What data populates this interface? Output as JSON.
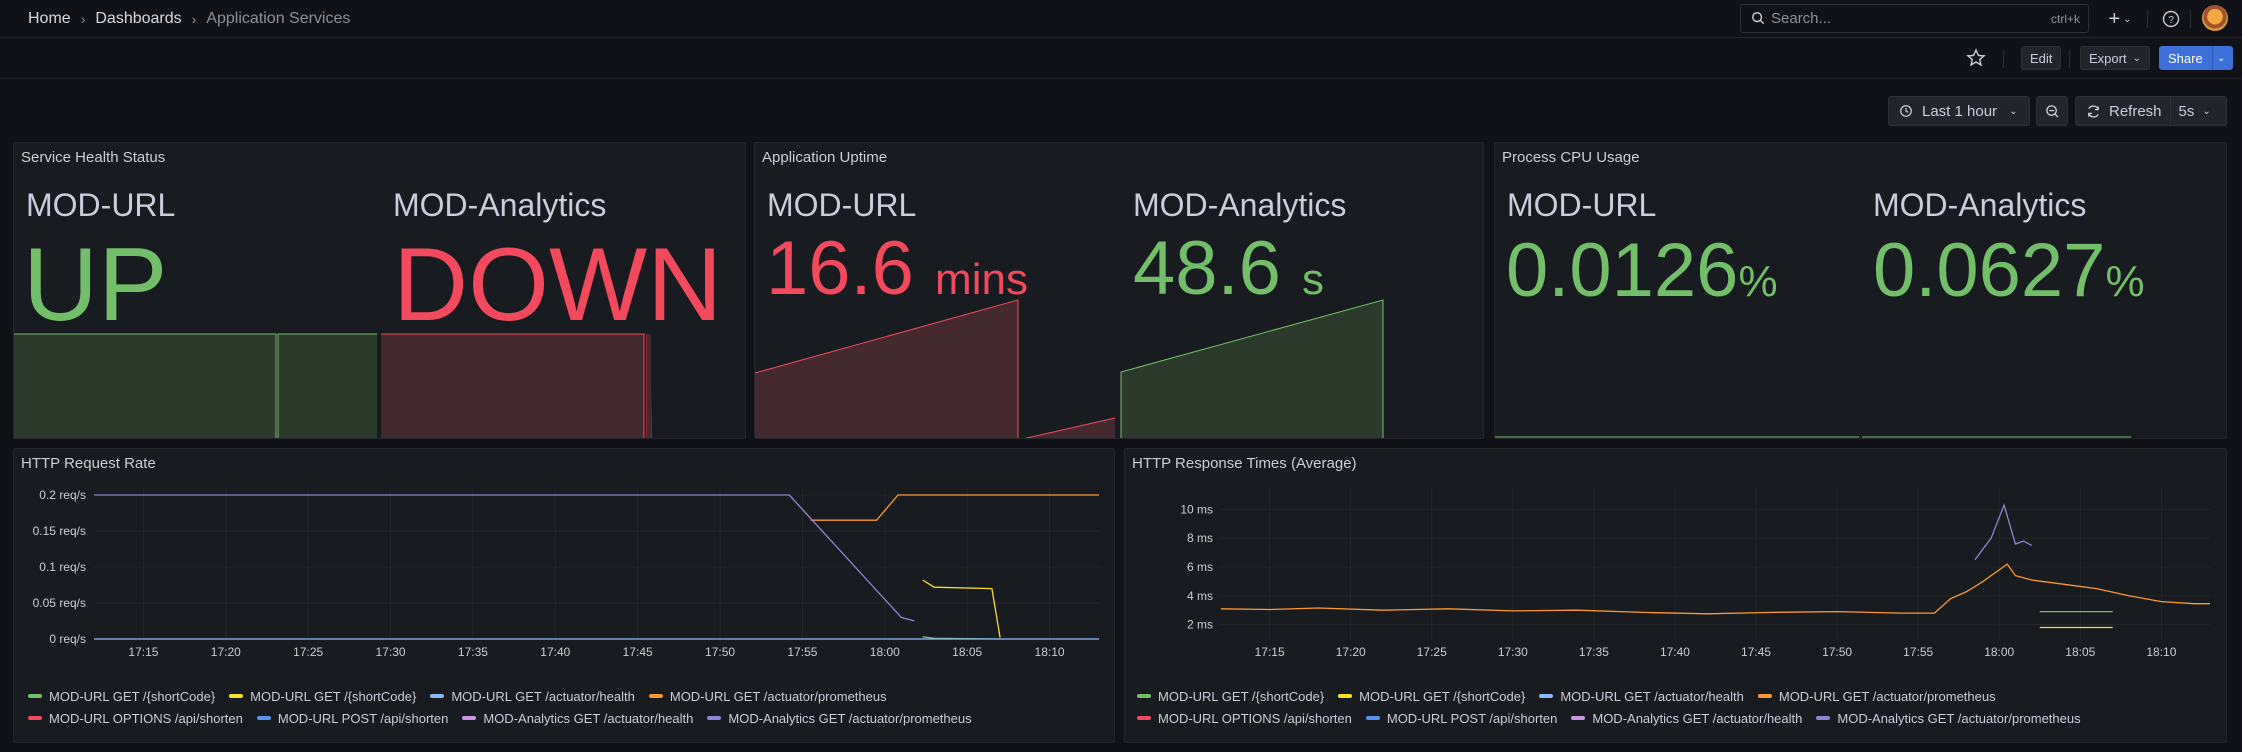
{
  "breadcrumb": {
    "home": "Home",
    "dashboards": "Dashboards",
    "current": "Application Services"
  },
  "search": {
    "placeholder": "Search...",
    "shortcut": "ctrl+k"
  },
  "toolbar": {
    "edit_label": "Edit",
    "export_label": "Export",
    "share_label": "Share"
  },
  "time_controls": {
    "range": "Last 1 hour",
    "refresh_label": "Refresh",
    "refresh_interval": "5s"
  },
  "colors": {
    "green": "#73bf69",
    "red": "#f2495c",
    "yellow": "#fade2a",
    "orange": "#ff9830",
    "blue": "#8ab8ff",
    "violet": "#8f84d6",
    "purple": "#ca95e5",
    "accent": "#3d71d9"
  },
  "panels": {
    "health": {
      "title": "Service Health Status",
      "items": [
        {
          "name": "MOD-URL",
          "value": "UP",
          "color": "green"
        },
        {
          "name": "MOD-Analytics",
          "value": "DOWN",
          "color": "red"
        }
      ]
    },
    "uptime": {
      "title": "Application Uptime",
      "items": [
        {
          "name": "MOD-URL",
          "value": "16.6",
          "unit": "mins",
          "color": "red"
        },
        {
          "name": "MOD-Analytics",
          "value": "48.6",
          "unit": "s",
          "color": "green"
        }
      ]
    },
    "cpu": {
      "title": "Process CPU Usage",
      "items": [
        {
          "name": "MOD-URL",
          "value": "0.0126",
          "unit": "%",
          "color": "green"
        },
        {
          "name": "MOD-Analytics",
          "value": "0.0627",
          "unit": "%",
          "color": "green"
        }
      ]
    },
    "request_rate": {
      "title": "HTTP Request Rate"
    },
    "response_times": {
      "title": "HTTP Response Times (Average)"
    }
  },
  "legend": [
    {
      "label": "MOD-URL GET /{shortCode}",
      "color": "#73bf69"
    },
    {
      "label": "MOD-URL GET /{shortCode}",
      "color": "#fade2a"
    },
    {
      "label": "MOD-URL GET /actuator/health",
      "color": "#8ab8ff"
    },
    {
      "label": "MOD-URL GET /actuator/prometheus",
      "color": "#ff9830"
    },
    {
      "label": "MOD-URL OPTIONS /api/shorten",
      "color": "#f2495c"
    },
    {
      "label": "MOD-URL POST /api/shorten",
      "color": "#5794f2"
    },
    {
      "label": "MOD-Analytics GET /actuator/health",
      "color": "#ca95e5"
    },
    {
      "label": "MOD-Analytics GET /actuator/prometheus",
      "color": "#8f84d6"
    }
  ],
  "chart_data": [
    {
      "type": "line",
      "title": "HTTP Request Rate",
      "x": [
        "17:15",
        "17:20",
        "17:25",
        "17:30",
        "17:35",
        "17:40",
        "17:45",
        "17:50",
        "17:55",
        "18:00",
        "18:05",
        "18:10"
      ],
      "xlim": [
        "17:12",
        "18:13"
      ],
      "ylim": [
        0,
        0.2
      ],
      "yticks": [
        "0 req/s",
        "0.05 req/s",
        "0.1 req/s",
        "0.15 req/s",
        "0.2 req/s"
      ],
      "series": [
        {
          "name": "MOD-URL GET /actuator/prometheus",
          "color": "#ff9830",
          "points": [
            [
              "17:55.5",
              0.165
            ],
            [
              "17:59.5",
              0.165
            ],
            [
              "18:00.8",
              0.2
            ],
            [
              "18:13",
              0.2
            ]
          ]
        },
        {
          "name": "MOD-Analytics GET /actuator/prometheus",
          "color": "#8f84d6",
          "points": [
            [
              "17:12",
              0.2
            ],
            [
              "17:54.2",
              0.2
            ],
            [
              "17:55.2",
              0.175
            ],
            [
              "17:57",
              0.13
            ],
            [
              "18:01",
              0.03
            ],
            [
              "18:01.8",
              0.025
            ]
          ]
        },
        {
          "name": "MOD-URL GET /{shortCode}",
          "color": "#fade2a",
          "points": [
            [
              "18:02.3",
              0.082
            ],
            [
              "18:03",
              0.072
            ],
            [
              "18:06.5",
              0.07
            ],
            [
              "18:07",
              0.002
            ]
          ]
        },
        {
          "name": "MOD-URL GET /{shortCode}",
          "color": "#73bf69",
          "points": [
            [
              "18:02.3",
              0.003
            ],
            [
              "18:03",
              0.001
            ],
            [
              "18:07",
              0.0
            ]
          ]
        },
        {
          "name": "MOD-URL GET /actuator/health",
          "color": "#8ab8ff",
          "points": [
            [
              "17:12",
              0.0
            ],
            [
              "18:13",
              0.0
            ]
          ]
        }
      ]
    },
    {
      "type": "line",
      "title": "HTTP Response Times (Average)",
      "x": [
        "17:15",
        "17:20",
        "17:25",
        "17:30",
        "17:35",
        "17:40",
        "17:45",
        "17:50",
        "17:55",
        "18:00",
        "18:05",
        "18:10"
      ],
      "xlim": [
        "17:12",
        "18:13"
      ],
      "ylim": [
        1,
        11
      ],
      "yticks": [
        "2 ms",
        "4 ms",
        "6 ms",
        "8 ms",
        "10 ms"
      ],
      "series": [
        {
          "name": "MOD-URL GET /actuator/prometheus",
          "color": "#ff9830",
          "points": [
            [
              "17:12",
              3.1
            ],
            [
              "17:15",
              3.05
            ],
            [
              "17:18",
              3.15
            ],
            [
              "17:22",
              3.0
            ],
            [
              "17:26",
              3.1
            ],
            [
              "17:30",
              2.95
            ],
            [
              "17:34",
              3.0
            ],
            [
              "17:38",
              2.85
            ],
            [
              "17:42",
              2.75
            ],
            [
              "17:46",
              2.85
            ],
            [
              "17:50",
              2.9
            ],
            [
              "17:54",
              2.8
            ],
            [
              "17:56",
              2.8
            ],
            [
              "17:57",
              3.8
            ],
            [
              "17:58",
              4.3
            ],
            [
              "17:59",
              5.0
            ],
            [
              "18:00",
              5.8
            ],
            [
              "18:00.5",
              6.2
            ],
            [
              "18:01",
              5.4
            ],
            [
              "18:02",
              5.1
            ],
            [
              "18:04",
              4.8
            ],
            [
              "18:06",
              4.5
            ],
            [
              "18:08",
              4.0
            ],
            [
              "18:10",
              3.6
            ],
            [
              "18:12",
              3.45
            ],
            [
              "18:13",
              3.45
            ]
          ]
        },
        {
          "name": "MOD-Analytics GET /actuator/prometheus",
          "color": "#8f84d6",
          "points": [
            [
              "17:58.5",
              6.5
            ],
            [
              "17:59.5",
              8.0
            ],
            [
              "18:00.3",
              10.3
            ],
            [
              "18:01",
              7.6
            ],
            [
              "18:01.5",
              7.8
            ],
            [
              "18:02",
              7.5
            ]
          ]
        },
        {
          "name": "MOD-URL GET /{shortCode}",
          "color": "#73bf69",
          "points": [
            [
              "18:02.5",
              2.9
            ],
            [
              "18:07",
              2.9
            ]
          ]
        },
        {
          "name": "MOD-URL GET /{shortCode}",
          "color": "#fade2a",
          "points": [
            [
              "18:02.5",
              1.8
            ],
            [
              "18:07",
              1.8
            ]
          ]
        }
      ]
    }
  ]
}
